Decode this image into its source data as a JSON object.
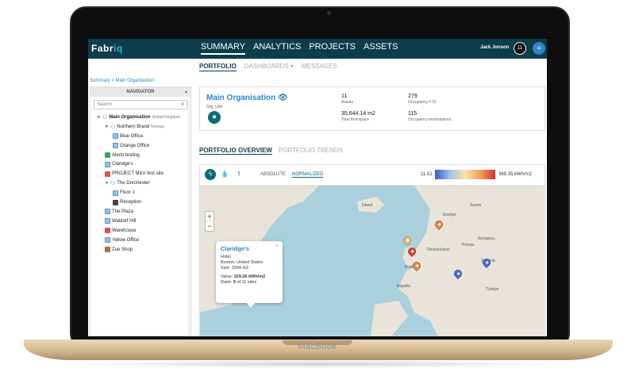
{
  "device_label": "MacBook",
  "app": {
    "logo_main": "Fabr",
    "logo_accent": "iq"
  },
  "nav": {
    "tabs": [
      "SUMMARY",
      "ANALYTICS",
      "PROJECTS",
      "ASSETS"
    ],
    "active": "SUMMARY"
  },
  "user": {
    "name": "Jack Jonson",
    "badge": "11",
    "menu_icon": "≡"
  },
  "subnav": {
    "tabs": [
      "PORTFOLIO",
      "DASHBOARDS ▾",
      "MESSAGES"
    ]
  },
  "breadcrumb": "Summary > Main Organisation",
  "navigator": {
    "title": "NAVIGATOR",
    "search_placeholder": "Search",
    "items": [
      {
        "label": "Main Organisation",
        "sub": "United Kingdom",
        "level": 0,
        "icon": "hierarchy-icon",
        "bold": true,
        "caret": true
      },
      {
        "label": "Northern Brand",
        "sub": "Norway",
        "level": 1,
        "icon": "hierarchy-icon",
        "caret": true
      },
      {
        "label": "Blue Office",
        "sub": "",
        "level": 2,
        "icon": "building-icon"
      },
      {
        "label": "Orange Office",
        "sub": "",
        "level": 2,
        "icon": "building-icon"
      },
      {
        "label": "Alerts testing",
        "sub": "",
        "level": 1,
        "icon": "green-building-icon"
      },
      {
        "label": "Claridge's",
        "sub": "",
        "level": 1,
        "icon": "building-icon"
      },
      {
        "label": "PROJECT M&V test site",
        "sub": "",
        "level": 1,
        "icon": "red-building-icon"
      },
      {
        "label": "The Dorchester",
        "sub": "",
        "level": 1,
        "icon": "hierarchy-icon",
        "caret": true
      },
      {
        "label": "Floor 1",
        "sub": "",
        "level": 2,
        "icon": "building-icon"
      },
      {
        "label": "Reception",
        "sub": "",
        "level": 2,
        "icon": "dark-building-icon"
      },
      {
        "label": "The Plaza",
        "sub": "",
        "level": 1,
        "icon": "building-icon"
      },
      {
        "label": "Waldorf Hill",
        "sub": "",
        "level": 1,
        "icon": "building-icon"
      },
      {
        "label": "Warehouse",
        "sub": "",
        "level": 1,
        "icon": "red-building-icon"
      },
      {
        "label": "Yellow Office",
        "sub": "",
        "level": 1,
        "icon": "building-icon"
      },
      {
        "label": "Zue Shop",
        "sub": "",
        "level": 1,
        "icon": "brown-building-icon"
      }
    ]
  },
  "summary": {
    "title": "Main Organisation",
    "org_label": "Org. Unit",
    "stats": [
      {
        "value": "11",
        "label": "Assets"
      },
      {
        "value": "279",
        "label": "Occupancy FTE"
      },
      {
        "value": "35,644.14 m2",
        "label": "Total floorspace"
      },
      {
        "value": "115",
        "label": "Occupancy workstations"
      }
    ]
  },
  "section_tabs": [
    "PORTFOLIO OVERVIEW",
    "PORTFOLIO TRENDS"
  ],
  "map_tools": {
    "mode_absolute": "ABSOLUTE",
    "mode_normalized": "NORMALIZED",
    "legend_min": "11.51",
    "legend_max": "369.35",
    "legend_unit": "kWh/m2",
    "zoom_in": "+",
    "zoom_out": "−"
  },
  "popup": {
    "title": "Claridge's",
    "type": "Hotel",
    "location": "Boston, United States",
    "size": "Size: 1504 m2",
    "value_prefix": "Value: ",
    "value": "329.26 kWh/m2",
    "rank_prefix": "Rank: ",
    "rank": "9",
    "rank_suffix": " of 11 sites",
    "close": "×"
  },
  "map_labels": [
    "Ísland",
    "Sverige",
    "Suomi",
    "Deutschland",
    "Україна",
    "España",
    "Türkiye",
    "Polska",
    "France",
    "Беларусь"
  ],
  "pin_colors": {
    "boston": "#e07a4f",
    "scandinavia_yellow": "#f2c36b",
    "scandinavia_orange": "#e88a4a",
    "uk_red": "#d74e3a",
    "uk_orange": "#e48a54",
    "blue": "#4a6fc9"
  }
}
